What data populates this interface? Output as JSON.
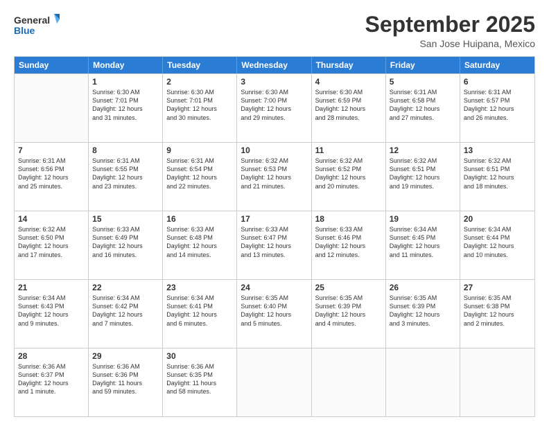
{
  "logo": {
    "line1": "General",
    "line2": "Blue"
  },
  "title": "September 2025",
  "location": "San Jose Huipana, Mexico",
  "days_header": [
    "Sunday",
    "Monday",
    "Tuesday",
    "Wednesday",
    "Thursday",
    "Friday",
    "Saturday"
  ],
  "weeks": [
    [
      {
        "day": "",
        "text": ""
      },
      {
        "day": "1",
        "text": "Sunrise: 6:30 AM\nSunset: 7:01 PM\nDaylight: 12 hours\nand 31 minutes."
      },
      {
        "day": "2",
        "text": "Sunrise: 6:30 AM\nSunset: 7:01 PM\nDaylight: 12 hours\nand 30 minutes."
      },
      {
        "day": "3",
        "text": "Sunrise: 6:30 AM\nSunset: 7:00 PM\nDaylight: 12 hours\nand 29 minutes."
      },
      {
        "day": "4",
        "text": "Sunrise: 6:30 AM\nSunset: 6:59 PM\nDaylight: 12 hours\nand 28 minutes."
      },
      {
        "day": "5",
        "text": "Sunrise: 6:31 AM\nSunset: 6:58 PM\nDaylight: 12 hours\nand 27 minutes."
      },
      {
        "day": "6",
        "text": "Sunrise: 6:31 AM\nSunset: 6:57 PM\nDaylight: 12 hours\nand 26 minutes."
      }
    ],
    [
      {
        "day": "7",
        "text": "Sunrise: 6:31 AM\nSunset: 6:56 PM\nDaylight: 12 hours\nand 25 minutes."
      },
      {
        "day": "8",
        "text": "Sunrise: 6:31 AM\nSunset: 6:55 PM\nDaylight: 12 hours\nand 23 minutes."
      },
      {
        "day": "9",
        "text": "Sunrise: 6:31 AM\nSunset: 6:54 PM\nDaylight: 12 hours\nand 22 minutes."
      },
      {
        "day": "10",
        "text": "Sunrise: 6:32 AM\nSunset: 6:53 PM\nDaylight: 12 hours\nand 21 minutes."
      },
      {
        "day": "11",
        "text": "Sunrise: 6:32 AM\nSunset: 6:52 PM\nDaylight: 12 hours\nand 20 minutes."
      },
      {
        "day": "12",
        "text": "Sunrise: 6:32 AM\nSunset: 6:51 PM\nDaylight: 12 hours\nand 19 minutes."
      },
      {
        "day": "13",
        "text": "Sunrise: 6:32 AM\nSunset: 6:51 PM\nDaylight: 12 hours\nand 18 minutes."
      }
    ],
    [
      {
        "day": "14",
        "text": "Sunrise: 6:32 AM\nSunset: 6:50 PM\nDaylight: 12 hours\nand 17 minutes."
      },
      {
        "day": "15",
        "text": "Sunrise: 6:33 AM\nSunset: 6:49 PM\nDaylight: 12 hours\nand 16 minutes."
      },
      {
        "day": "16",
        "text": "Sunrise: 6:33 AM\nSunset: 6:48 PM\nDaylight: 12 hours\nand 14 minutes."
      },
      {
        "day": "17",
        "text": "Sunrise: 6:33 AM\nSunset: 6:47 PM\nDaylight: 12 hours\nand 13 minutes."
      },
      {
        "day": "18",
        "text": "Sunrise: 6:33 AM\nSunset: 6:46 PM\nDaylight: 12 hours\nand 12 minutes."
      },
      {
        "day": "19",
        "text": "Sunrise: 6:34 AM\nSunset: 6:45 PM\nDaylight: 12 hours\nand 11 minutes."
      },
      {
        "day": "20",
        "text": "Sunrise: 6:34 AM\nSunset: 6:44 PM\nDaylight: 12 hours\nand 10 minutes."
      }
    ],
    [
      {
        "day": "21",
        "text": "Sunrise: 6:34 AM\nSunset: 6:43 PM\nDaylight: 12 hours\nand 9 minutes."
      },
      {
        "day": "22",
        "text": "Sunrise: 6:34 AM\nSunset: 6:42 PM\nDaylight: 12 hours\nand 7 minutes."
      },
      {
        "day": "23",
        "text": "Sunrise: 6:34 AM\nSunset: 6:41 PM\nDaylight: 12 hours\nand 6 minutes."
      },
      {
        "day": "24",
        "text": "Sunrise: 6:35 AM\nSunset: 6:40 PM\nDaylight: 12 hours\nand 5 minutes."
      },
      {
        "day": "25",
        "text": "Sunrise: 6:35 AM\nSunset: 6:39 PM\nDaylight: 12 hours\nand 4 minutes."
      },
      {
        "day": "26",
        "text": "Sunrise: 6:35 AM\nSunset: 6:39 PM\nDaylight: 12 hours\nand 3 minutes."
      },
      {
        "day": "27",
        "text": "Sunrise: 6:35 AM\nSunset: 6:38 PM\nDaylight: 12 hours\nand 2 minutes."
      }
    ],
    [
      {
        "day": "28",
        "text": "Sunrise: 6:36 AM\nSunset: 6:37 PM\nDaylight: 12 hours\nand 1 minute."
      },
      {
        "day": "29",
        "text": "Sunrise: 6:36 AM\nSunset: 6:36 PM\nDaylight: 11 hours\nand 59 minutes."
      },
      {
        "day": "30",
        "text": "Sunrise: 6:36 AM\nSunset: 6:35 PM\nDaylight: 11 hours\nand 58 minutes."
      },
      {
        "day": "",
        "text": ""
      },
      {
        "day": "",
        "text": ""
      },
      {
        "day": "",
        "text": ""
      },
      {
        "day": "",
        "text": ""
      }
    ]
  ]
}
